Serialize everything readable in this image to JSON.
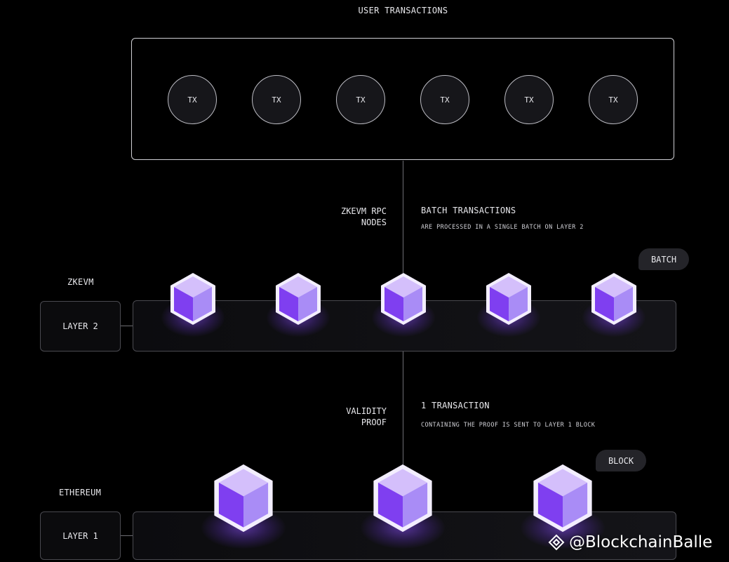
{
  "top": {
    "title": "USER TRANSACTIONS",
    "tx_items": [
      "TX",
      "TX",
      "TX",
      "TX",
      "TX",
      "TX"
    ]
  },
  "rpc": {
    "label_line1": "ZKEVM RPC",
    "label_line2": "NODES",
    "desc_title": "BATCH TRANSACTIONS",
    "desc_sub": "ARE PROCESSED IN A SINGLE BATCH ON LAYER 2"
  },
  "layer2": {
    "network": "ZKEVM",
    "tag": "LAYER 2",
    "pill": "BATCH",
    "cube_count": 5
  },
  "proof": {
    "label_line1": "VALIDITY",
    "label_line2": "PROOF",
    "desc_title": "1 TRANSACTION",
    "desc_sub": "CONTAINING THE PROOF IS SENT TO LAYER 1 BLOCK"
  },
  "layer1": {
    "network": "ETHEREUM",
    "tag": "LAYER 1",
    "pill": "BLOCK",
    "cube_count": 3
  },
  "watermark": {
    "logo_icon": "binance-diamond-icon",
    "text": "@BlockchainBalle"
  },
  "colors": {
    "cube_top": "#d4bffb",
    "cube_left": "#7f3ff0",
    "cube_right": "#a98cf6",
    "cube_outline": "#f3eefe",
    "glow": "#8b50ff"
  }
}
